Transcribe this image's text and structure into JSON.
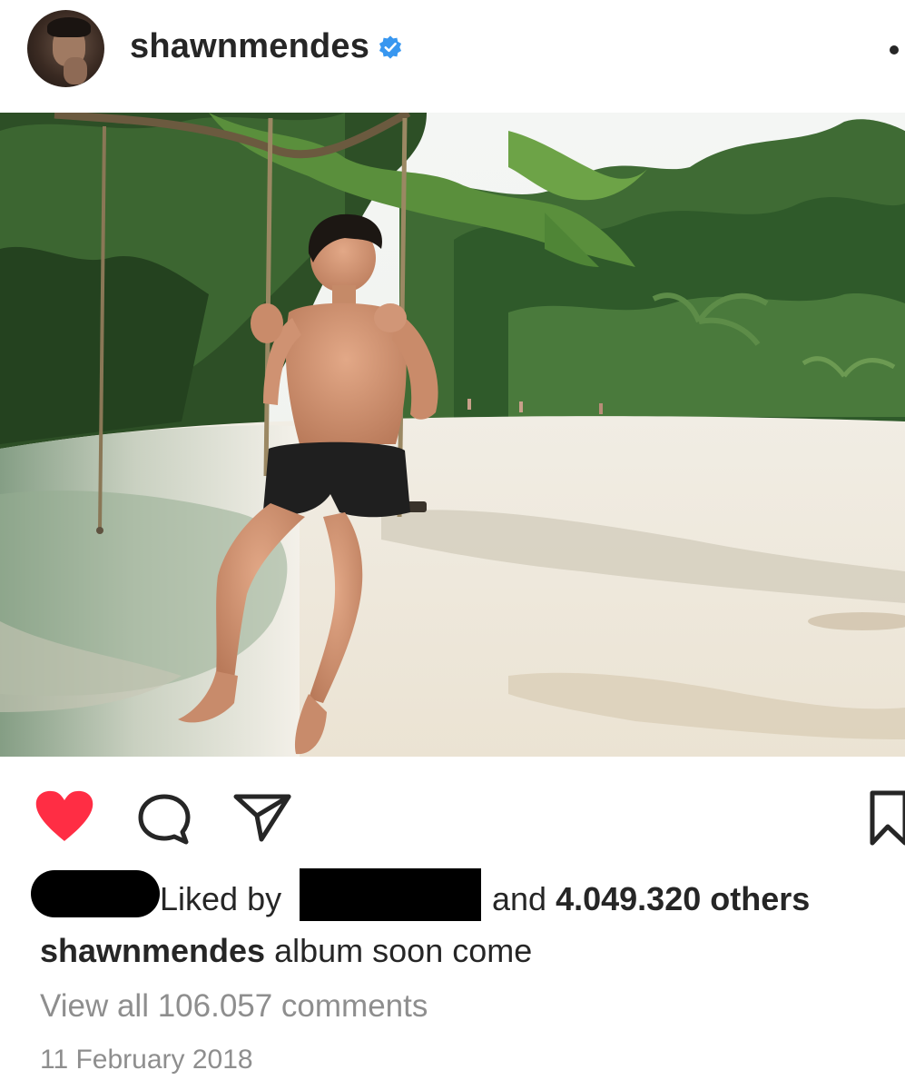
{
  "post": {
    "username": "shawnmendes",
    "verified": true,
    "caption_user": "shawnmendes",
    "caption_text": "album soon come",
    "liked_by_prefix": "Liked by",
    "liked_by_and": "and",
    "others_count_text": "4.049.320 others",
    "view_comments_text": "View all 106.057 comments",
    "date": "11 February 2018",
    "liked": true
  },
  "icons": {
    "avatar": "profile-avatar",
    "verified": "verified-badge-icon",
    "more": "more-options-icon",
    "like": "heart-icon",
    "comment": "comment-bubble-icon",
    "share": "paper-plane-icon",
    "save": "bookmark-icon"
  },
  "colors": {
    "like_red": "#ff2d44",
    "verified_blue": "#3897f0",
    "text_primary": "#262626",
    "text_secondary": "#8e8e8e"
  }
}
